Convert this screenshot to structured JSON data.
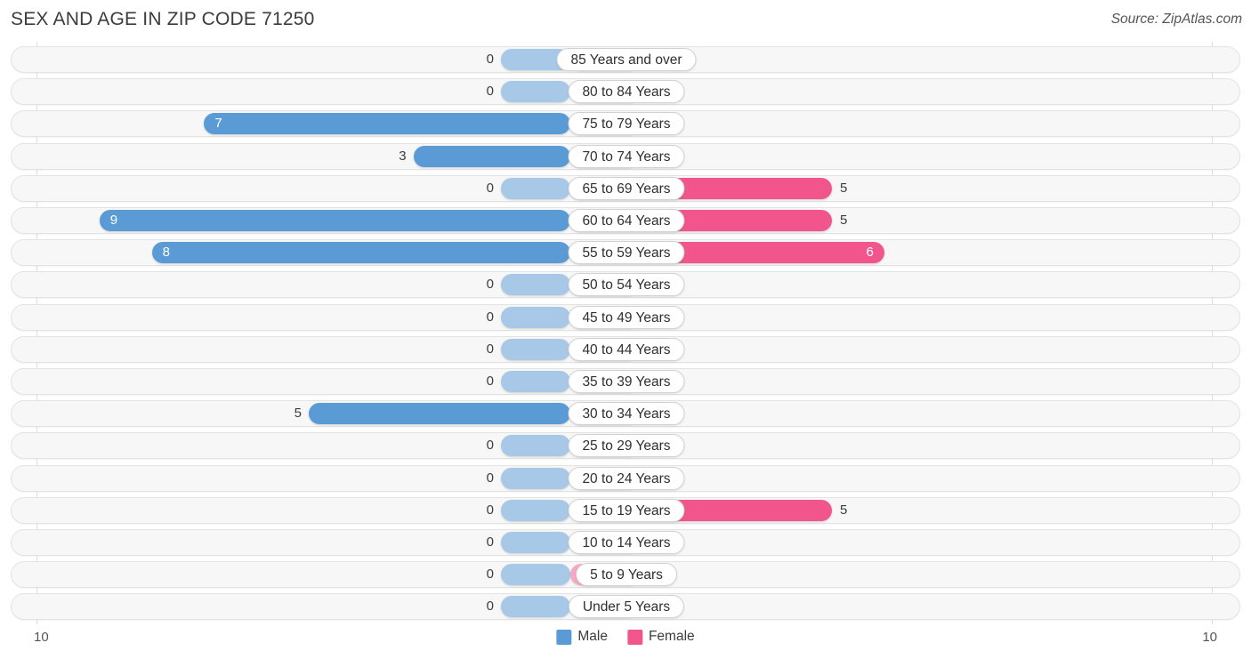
{
  "header": {
    "title": "SEX AND AGE IN ZIP CODE 71250",
    "source": "Source: ZipAtlas.com"
  },
  "axis": {
    "left_label": "10",
    "right_label": "10",
    "max": 10
  },
  "legend": {
    "male_label": "Male",
    "female_label": "Female",
    "male_color": "#5b9bd5",
    "female_color": "#f2558c"
  },
  "colors": {
    "male": "#5b9bd5",
    "female": "#f2558c",
    "male_zero": "#a8c8e8",
    "female_zero": "#f7a8c4",
    "row_track": "#f7f7f7",
    "row_border": "#e3e3e3",
    "gridline": "#dedede"
  },
  "chart_data": {
    "type": "bar",
    "title": "SEX AND AGE IN ZIP CODE 71250",
    "subtitle": "",
    "xlabel": "",
    "ylabel": "",
    "orientation": "horizontal",
    "layout": "population-pyramid",
    "xlim": [
      10,
      10
    ],
    "grid": true,
    "legend_position": "bottom-center",
    "categories": [
      "85 Years and over",
      "80 to 84 Years",
      "75 to 79 Years",
      "70 to 74 Years",
      "65 to 69 Years",
      "60 to 64 Years",
      "55 to 59 Years",
      "50 to 54 Years",
      "45 to 49 Years",
      "40 to 44 Years",
      "35 to 39 Years",
      "30 to 34 Years",
      "25 to 29 Years",
      "20 to 24 Years",
      "15 to 19 Years",
      "10 to 14 Years",
      "5 to 9 Years",
      "Under 5 Years"
    ],
    "series": [
      {
        "name": "Male",
        "values": [
          0,
          0,
          7,
          3,
          0,
          9,
          8,
          0,
          0,
          0,
          0,
          5,
          0,
          0,
          0,
          0,
          0,
          0
        ]
      },
      {
        "name": "Female",
        "values": [
          0,
          0,
          0,
          0,
          5,
          5,
          6,
          0,
          0,
          0,
          0,
          0,
          0,
          0,
          5,
          0,
          0,
          0
        ]
      }
    ]
  }
}
